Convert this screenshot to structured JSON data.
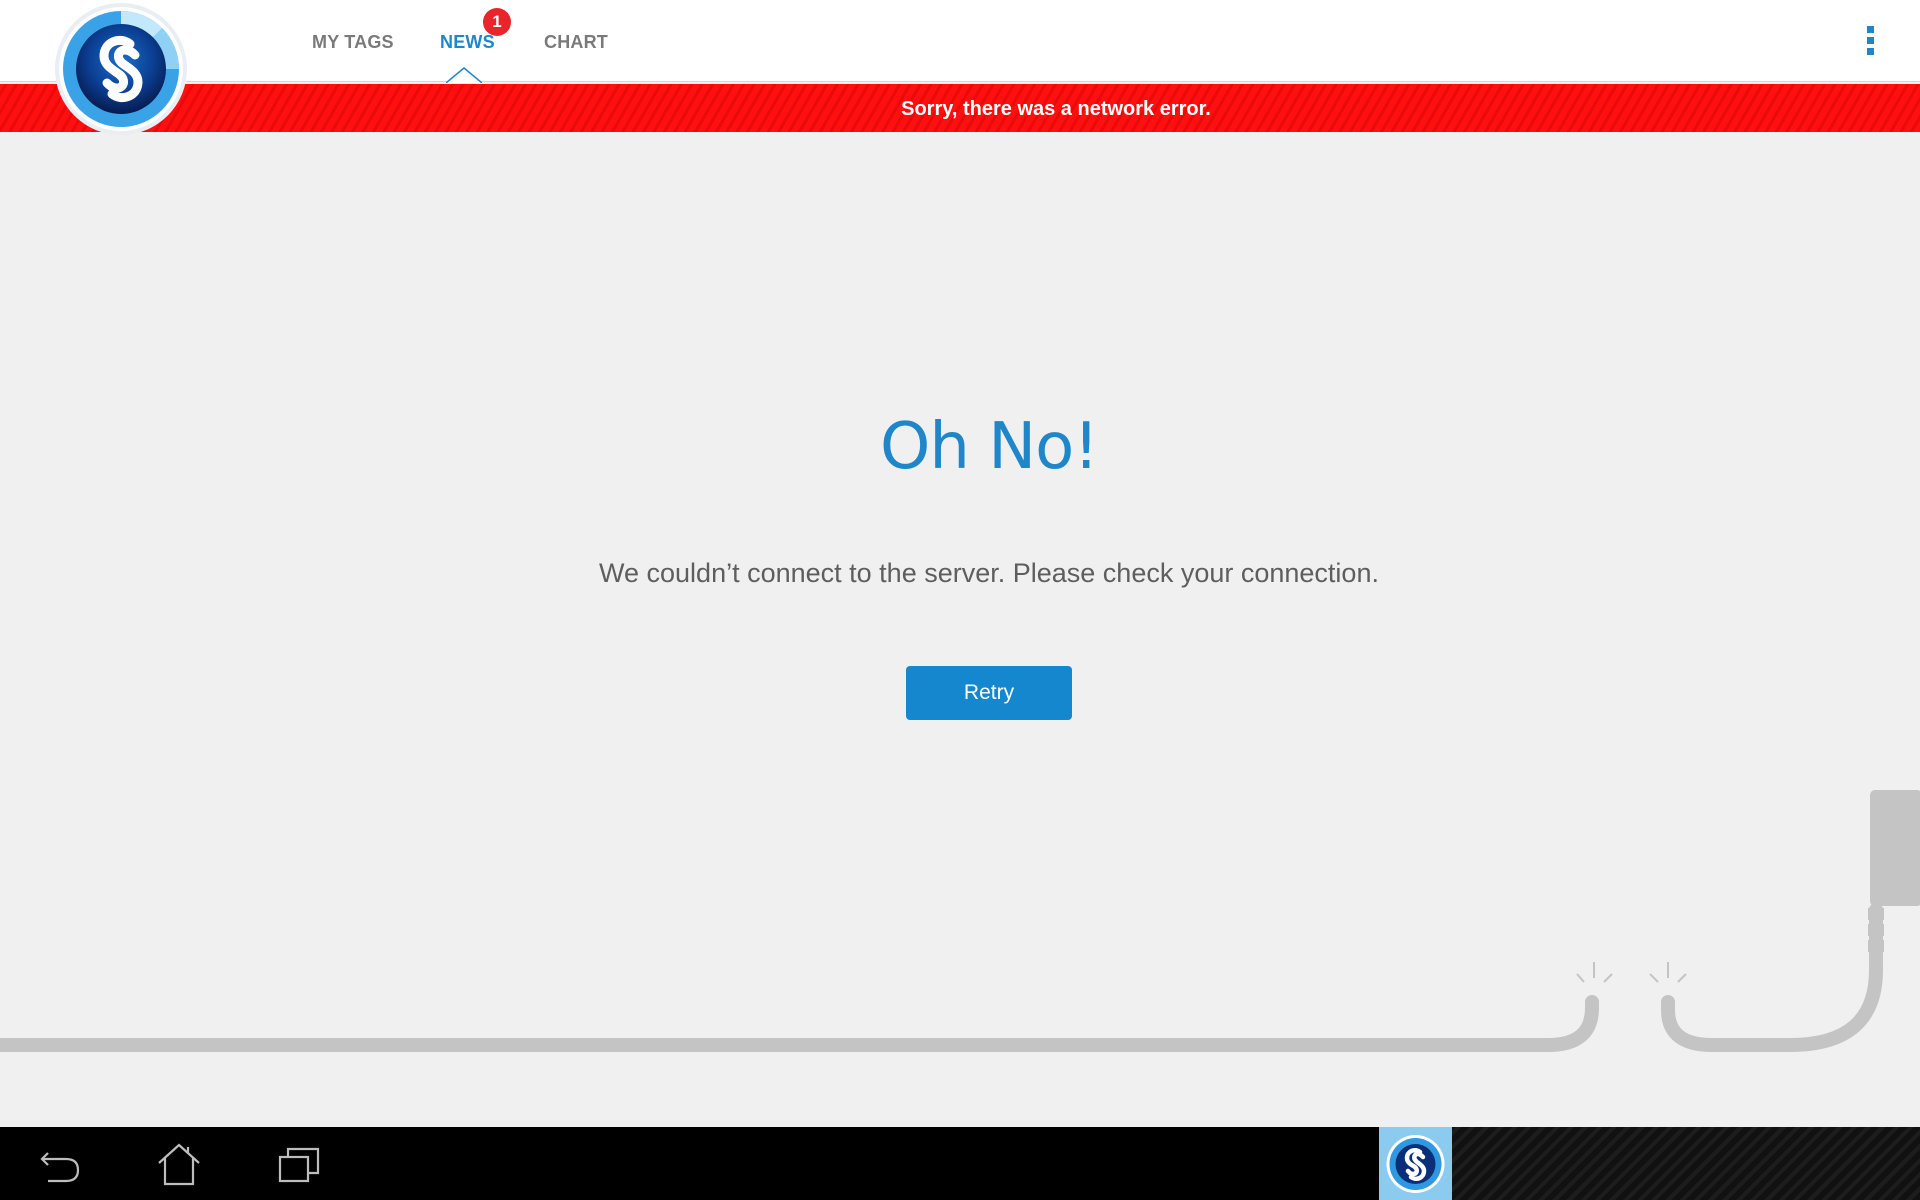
{
  "header": {
    "tabs": [
      {
        "label": "MY TAGS",
        "active": false
      },
      {
        "label": "NEWS",
        "active": true,
        "badge": "1"
      },
      {
        "label": "CHART",
        "active": false
      }
    ],
    "logo_icon": "shazam-logo-icon",
    "menu_icon": "overflow-menu-icon"
  },
  "error_banner": {
    "text": "Sorry, there was a network error."
  },
  "main": {
    "headline": "Oh No!",
    "message": "We couldn’t connect to the server. Please check your connection.",
    "retry_label": "Retry"
  },
  "system_nav": {
    "back_icon": "back-icon",
    "home_icon": "home-icon",
    "recent_icon": "recent-apps-icon",
    "app_icon": "shazam-app-icon"
  },
  "colors": {
    "accent": "#1f87c9",
    "error": "#ff0f0f",
    "background": "#f0f0f0",
    "navbar": "#000000"
  }
}
